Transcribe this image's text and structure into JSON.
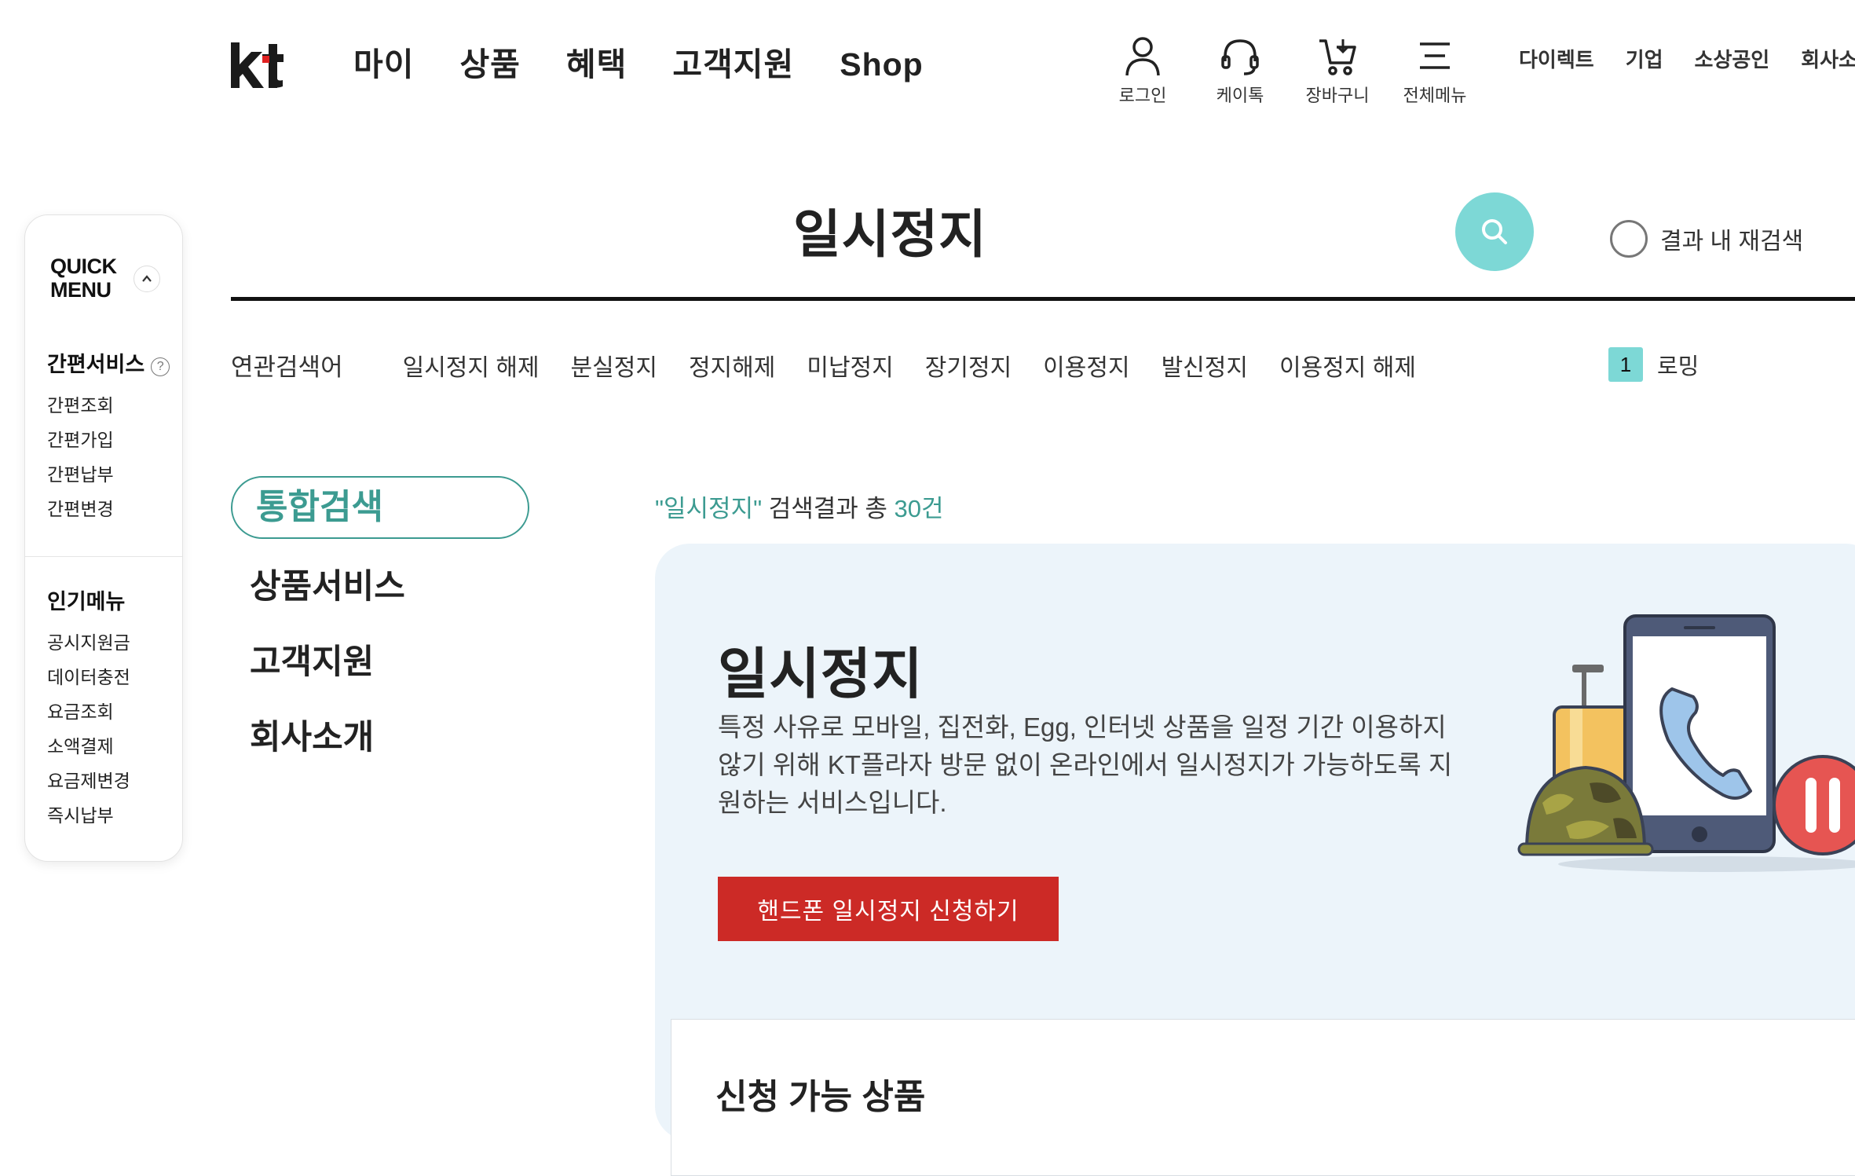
{
  "header": {
    "logo_text": "kt",
    "main_nav": [
      "마이",
      "상품",
      "혜택",
      "고객지원",
      "Shop"
    ],
    "utility": {
      "login": "로그인",
      "katalk": "케이톡",
      "cart": "장바구니",
      "all_menu": "전체메뉴"
    },
    "sub_nav": [
      "다이렉트",
      "기업",
      "소상공인",
      "회사소개"
    ]
  },
  "quick_menu": {
    "title_line1": "QUICK",
    "title_line2": "MENU",
    "easy_service_title": "간편서비스",
    "easy_items": [
      "간편조회",
      "간편가입",
      "간편납부",
      "간편변경"
    ],
    "popular_title": "인기메뉴",
    "popular_items": [
      "공시지원금",
      "데이터충전",
      "요금조회",
      "소액결제",
      "요금제변경",
      "즉시납부"
    ]
  },
  "search": {
    "term": "일시정지",
    "within_results_label": "결과 내 재검색"
  },
  "related": {
    "label": "연관검색어",
    "terms": [
      "일시정지 해제",
      "분실정지",
      "정지해제",
      "미납정지",
      "장기정지",
      "이용정지",
      "발신정지",
      "이용정지 해제"
    ],
    "trending_rank": "1",
    "trending_term": "로밍"
  },
  "tabs": {
    "active": "통합검색",
    "items": [
      "상품서비스",
      "고객지원",
      "회사소개"
    ]
  },
  "results": {
    "quoted_term": "\"일시정지\"",
    "summary_text": " 검색결과 총 ",
    "count": "30건"
  },
  "card": {
    "title": "일시정지",
    "description": "특정 사유로 모바일, 집전화, Egg, 인터넷 상품을 일정 기간 이용하지 않기 위해 KT플라자 방문 없이 온라인에서 일시정지가 가능하도록 지원하는 서비스입니다.",
    "button_label": "핸드폰 일시정지 신청하기",
    "section_title": "신청 가능 상품"
  },
  "colors": {
    "accent_teal": "#3c9b91",
    "search_button": "#7dd8d6",
    "card_bg": "#ecf4fa",
    "cta_red": "#cc2a26"
  },
  "icons": [
    "search-icon",
    "user-icon",
    "headset-icon",
    "cart-icon",
    "menu-icon",
    "help-icon",
    "chevron-up-icon"
  ]
}
